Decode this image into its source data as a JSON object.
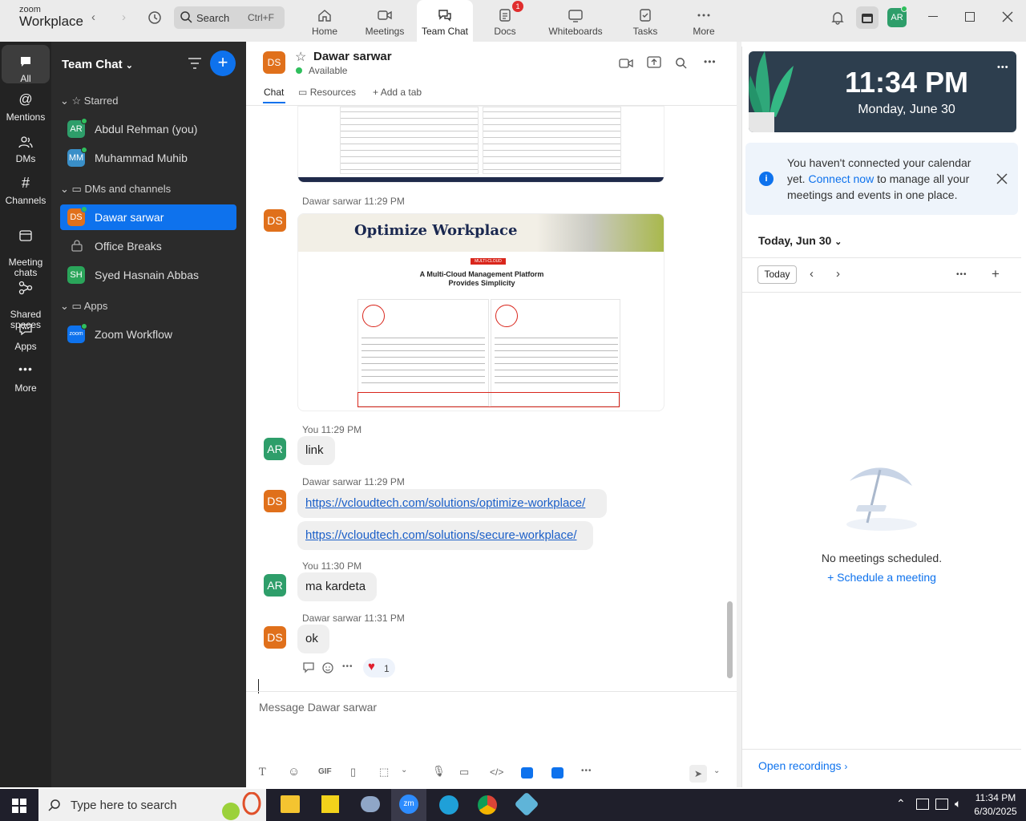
{
  "app": {
    "logo_top": "zoom",
    "logo_bottom": "Workplace"
  },
  "search": {
    "placeholder": "Search",
    "shortcut": "Ctrl+F"
  },
  "tabs": [
    {
      "label": "Home"
    },
    {
      "label": "Meetings"
    },
    {
      "label": "Team Chat"
    },
    {
      "label": "Docs",
      "badge": "1"
    },
    {
      "label": "Whiteboards"
    },
    {
      "label": "Tasks"
    },
    {
      "label": "More"
    }
  ],
  "user_avatar": "AR",
  "rail": [
    {
      "label": "All"
    },
    {
      "label": "Mentions"
    },
    {
      "label": "DMs"
    },
    {
      "label": "Channels"
    },
    {
      "label": "Meeting\nchats"
    },
    {
      "label": "Shared\nspaces"
    },
    {
      "label": "Apps"
    },
    {
      "label": "More"
    }
  ],
  "sidebar": {
    "title": "Team Chat",
    "starred_header": "Starred",
    "starred": [
      {
        "initials": "AR",
        "name": "Abdul Rehman (you)",
        "color": "#2e9e6a"
      },
      {
        "initials": "MM",
        "name": "Muhammad Muhib",
        "color": "#3a8fc8"
      }
    ],
    "dms_header": "DMs and channels",
    "dms": [
      {
        "initials": "DS",
        "name": "Dawar sarwar",
        "color": "#e0701b"
      },
      {
        "initials": "",
        "name": "Office Breaks",
        "color": ""
      },
      {
        "initials": "SH",
        "name": "Syed Hasnain Abbas",
        "color": "#2aa55a"
      }
    ],
    "apps_header": "Apps",
    "apps": [
      {
        "initials": "zoom",
        "name": "Zoom Workflow",
        "color": "#0e72ed"
      }
    ]
  },
  "chat": {
    "contact_initials": "DS",
    "contact_name": "Dawar sarwar",
    "status": "Available",
    "tabs": [
      "Chat",
      "Resources",
      "Add a tab"
    ],
    "image1": {
      "title": "Optimize Workplace",
      "tag": "MULTI-CLOUD",
      "subtitle1": "A Multi-Cloud Management Platform",
      "subtitle2": "Provides Simplicity"
    },
    "messages": [
      {
        "sender": "Dawar sarwar",
        "time": "11:29 PM",
        "initials": "DS"
      },
      {
        "sender": "You",
        "time": "11:29 PM",
        "initials": "AR",
        "text": "link"
      },
      {
        "sender": "Dawar sarwar",
        "time": "11:29 PM",
        "initials": "DS",
        "links": [
          "https://vcloudtech.com/solutions/optimize-workplace/",
          "https://vcloudtech.com/solutions/secure-workplace/"
        ]
      },
      {
        "sender": "You",
        "time": "11:30 PM",
        "initials": "AR",
        "text": "ma kardeta"
      },
      {
        "sender": "Dawar sarwar",
        "time": "11:31 PM",
        "initials": "DS",
        "text": "ok"
      }
    ],
    "reaction_count": "1",
    "composer_placeholder": "Message Dawar sarwar",
    "gif_label": "GIF"
  },
  "calendar": {
    "time": "11:34 PM",
    "date": "Monday, June 30",
    "notice_pre": "You haven't connected your calendar yet. ",
    "notice_link": "Connect now",
    "notice_post": " to manage all your meetings and events in one place.",
    "day_header": "Today, Jun 30",
    "today_btn": "Today",
    "empty_text": "No meetings scheduled.",
    "schedule_link": "Schedule a meeting",
    "recordings": "Open recordings"
  },
  "taskbar": {
    "search_placeholder": "Type here to search",
    "clock_time": "11:34 PM",
    "clock_date": "6/30/2025"
  },
  "colors": {
    "accent": "#0e72ed",
    "rail": "#232323",
    "sidebar": "#2b2b2b",
    "ds_avatar": "#e0701b",
    "ar_avatar": "#2e9e6a"
  }
}
